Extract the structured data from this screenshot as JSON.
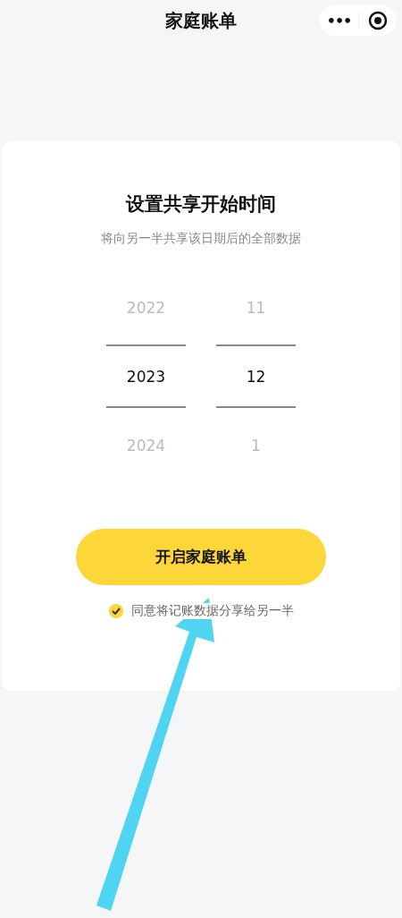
{
  "nav_bar": {
    "title": "家庭账单",
    "menu": "•••"
  },
  "card": {
    "title": "设置共享开始时间",
    "subtitle": "将向另一半共享该日期后的全部数据",
    "picker": [
      {
        "items": [
          {
            "label": "2022",
            "selected": false
          },
          {
            "label": "2023",
            "selected": true
          },
          {
            "label": "2024",
            "selected": false
          }
        ]
      },
      {
        "items": [
          {
            "label": "11",
            "selected": false
          },
          {
            "label": "12",
            "selected": true
          },
          {
            "label": "1",
            "selected": false
          }
        ]
      }
    ],
    "button": "开启家庭账单",
    "agreement": {
      "label": "同意将记账数据分享给另一半",
      "checked": true
    }
  },
  "annotation": {
    "kind": "arrow"
  }
}
